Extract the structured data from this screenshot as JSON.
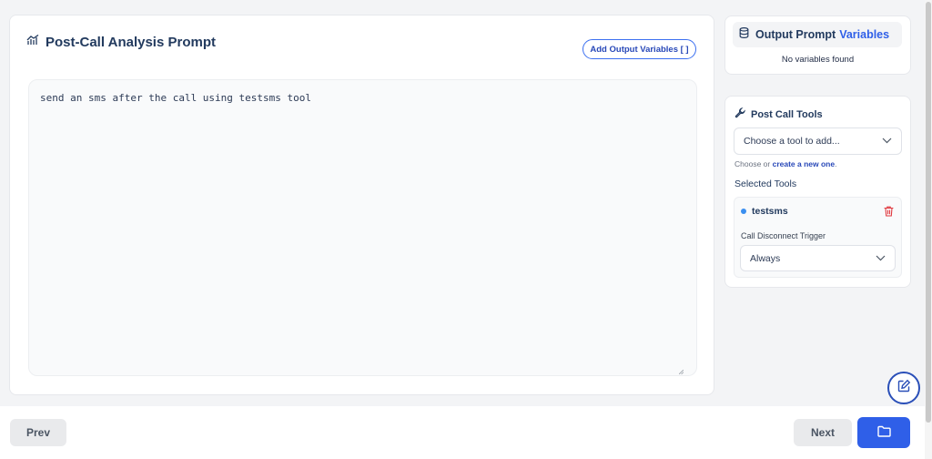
{
  "prompt_panel": {
    "title": "Post-Call Analysis Prompt",
    "add_variables_label": "Add Output Variables [ ]",
    "prompt_text": "send an sms after the call using testsms tool"
  },
  "variables_panel": {
    "title": "Output Prompt",
    "title_highlight": "Variables",
    "empty_text": "No variables found"
  },
  "tools_panel": {
    "title": "Post Call Tools",
    "select_placeholder": "Choose a tool to add...",
    "hint_prefix": "Choose or",
    "hint_link": "create a new one",
    "hint_suffix": ".",
    "selected_title": "Selected Tools",
    "selected_tools": [
      {
        "name": "testsms",
        "trigger_label": "Call Disconnect Trigger",
        "trigger_value": "Always"
      }
    ]
  },
  "footer": {
    "prev_label": "Prev",
    "next_label": "Next"
  },
  "icons": {
    "title_icon": "chart-icon",
    "variables_icon": "database-icon",
    "tools_icon": "wrench-icon",
    "delete_icon": "trash-icon",
    "save_icon": "folder-icon",
    "float_icon": "edit-icon"
  },
  "colors": {
    "accent": "#2f5fe8",
    "delete": "#e0383e"
  }
}
